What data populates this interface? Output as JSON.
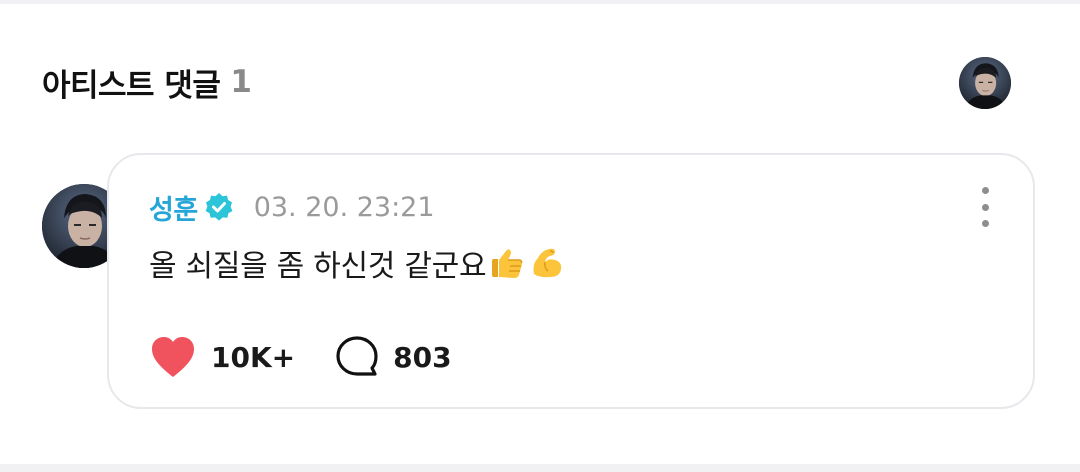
{
  "section": {
    "title": "아티스트 댓글",
    "count": "1"
  },
  "comment": {
    "author": "성훈",
    "timestamp": "03. 20. 23:21",
    "text": "올 쇠질을 좀 하신것 같군요",
    "emojis": [
      "thumbs-up-emoji",
      "flexed-biceps-emoji"
    ],
    "like_count": "10K+",
    "reply_count": "803"
  },
  "colors": {
    "author": "#26a5d8",
    "verified_badge": "#2bc4d8",
    "like_heart": "#f0525e",
    "timestamp": "#9a9a9a",
    "card_border": "#e8e8ec"
  }
}
